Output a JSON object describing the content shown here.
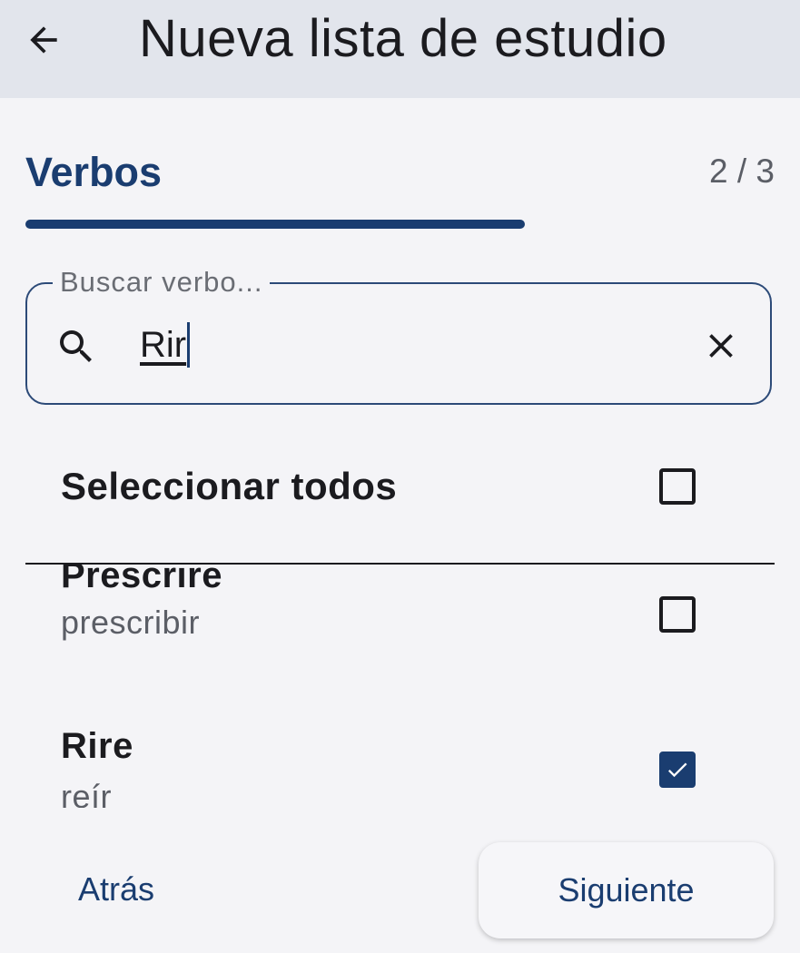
{
  "app_bar": {
    "title": "Nueva lista de estudio",
    "back_icon": "arrow-left-icon"
  },
  "step": {
    "title": "Verbos",
    "counter": "2 / 3",
    "progress": 0.667,
    "accent_color": "#1a3d70"
  },
  "search": {
    "label": "Buscar verbo...",
    "value": "Rir",
    "search_icon": "search-icon",
    "clear_icon": "close-icon"
  },
  "select_all": {
    "label": "Seleccionar todos",
    "checked": false
  },
  "verbs": [
    {
      "title": "Prescrire",
      "translation": "prescribir",
      "checked": false
    },
    {
      "title": "Rire",
      "translation": "reír",
      "checked": true
    }
  ],
  "footer": {
    "back_label": "Atrás",
    "next_label": "Siguiente"
  }
}
